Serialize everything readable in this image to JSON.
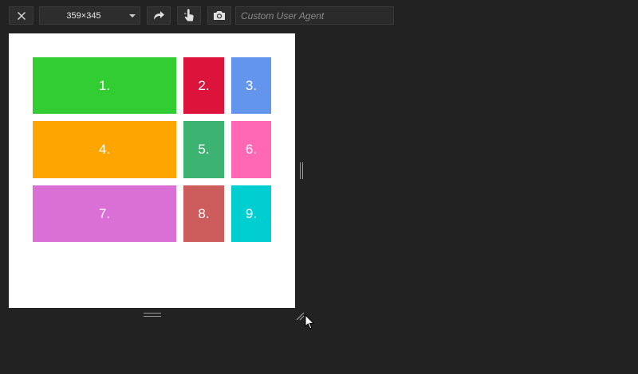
{
  "toolbar": {
    "close_icon": "close-icon",
    "size_value": "359×345",
    "rotate_icon": "rotate-icon",
    "touch_icon": "touch-icon",
    "screenshot_icon": "camera-icon",
    "user_agent_placeholder": "Custom User Agent"
  },
  "viewport": {
    "background": "#ffffff",
    "cells": [
      {
        "label": "1.",
        "color": "#32cd32"
      },
      {
        "label": "2.",
        "color": "#dc143c"
      },
      {
        "label": "3.",
        "color": "#6495ed"
      },
      {
        "label": "4.",
        "color": "#ffa500"
      },
      {
        "label": "5.",
        "color": "#3cb371"
      },
      {
        "label": "6.",
        "color": "#ff69b4"
      },
      {
        "label": "7.",
        "color": "#da70d6"
      },
      {
        "label": "8.",
        "color": "#cd5c5c"
      },
      {
        "label": "9.",
        "color": "#00ced1"
      }
    ]
  }
}
